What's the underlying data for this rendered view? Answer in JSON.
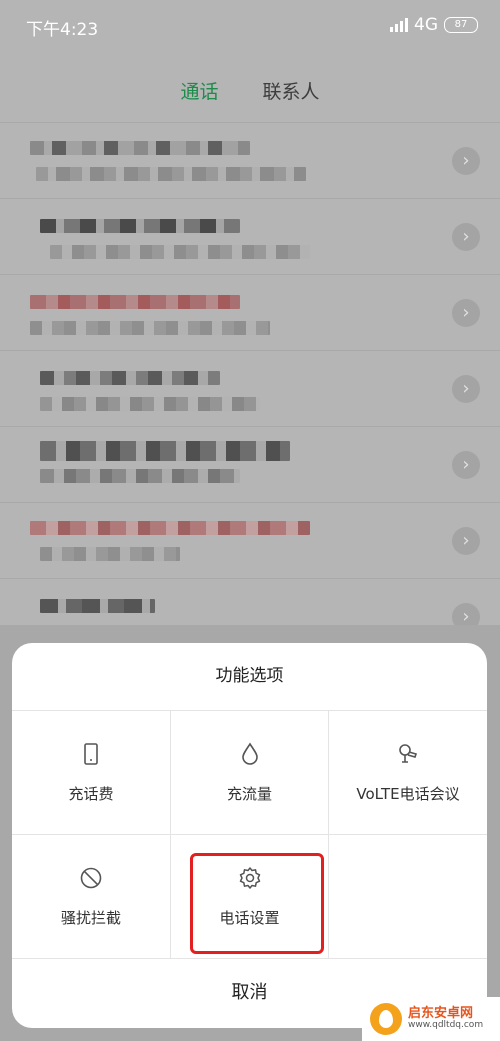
{
  "status_bar": {
    "time": "下午4:23",
    "network": "4G",
    "battery": "87"
  },
  "tabs": [
    {
      "label": "通话",
      "active": true
    },
    {
      "label": "联系人",
      "active": false
    }
  ],
  "sheet": {
    "title": "功能选项",
    "items": [
      {
        "label": "充话费",
        "icon": "phone-icon"
      },
      {
        "label": "充流量",
        "icon": "droplet-icon"
      },
      {
        "label": "VoLTE电话会议",
        "icon": "conference-icon"
      },
      {
        "label": "骚扰拦截",
        "icon": "block-icon"
      },
      {
        "label": "电话设置",
        "icon": "gear-icon"
      }
    ],
    "cancel_label": "取消"
  },
  "watermark": {
    "name": "启东安卓网",
    "url": "www.qdltdq.com"
  },
  "colors": {
    "accent": "#1d8b4a",
    "highlight": "#e31f1f"
  }
}
